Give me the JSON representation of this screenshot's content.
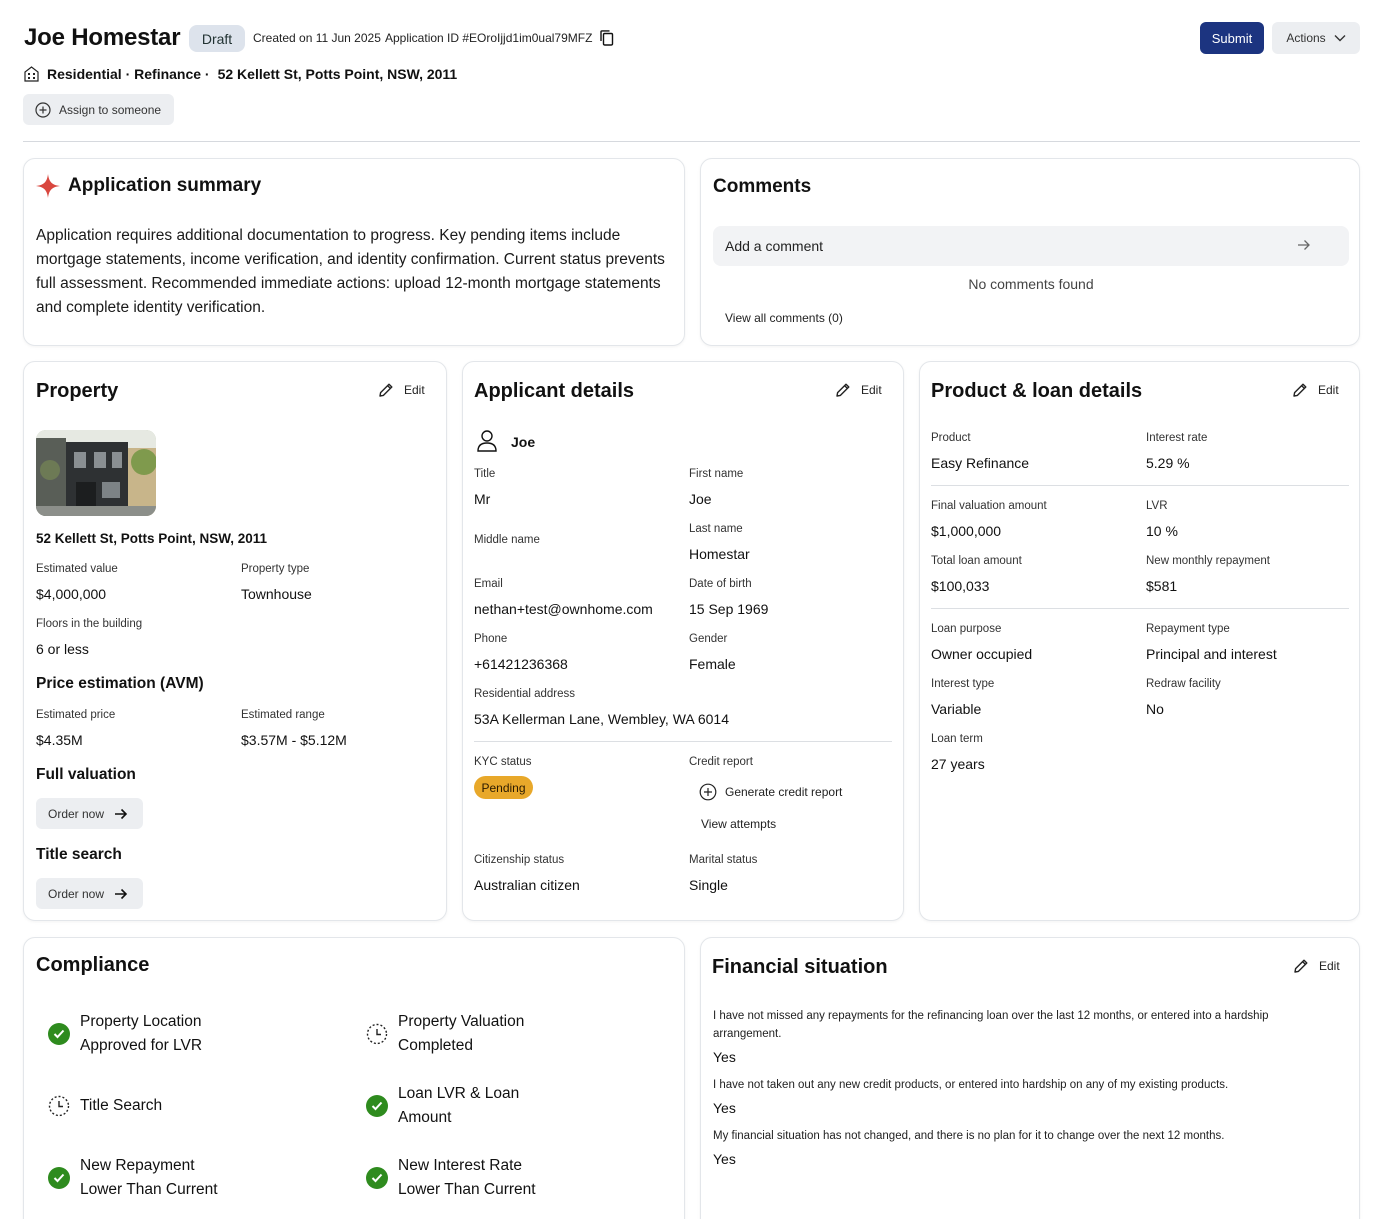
{
  "header": {
    "name": "Joe Homestar",
    "status": "Draft",
    "created": "Created on 11 Jun 2025",
    "app_id": "Application ID #EOroIjjd1im0ual79MFZ",
    "submit": "Submit",
    "actions": "Actions",
    "subline_type": "Residential · Refinance ·",
    "subline_address": "52 Kellett St, Potts Point, NSW, 2011",
    "assign": "Assign to someone"
  },
  "summary": {
    "title": "Application summary",
    "text": "Application requires additional documentation to progress. Key pending items include mortgage statements, income verification, and identity confirmation. Current status prevents full assessment. Recommended immediate actions: upload 12-month mortgage statements and complete identity verification."
  },
  "comments": {
    "title": "Comments",
    "placeholder": "Add a comment",
    "empty": "No comments found",
    "view_all": "View all comments (0)"
  },
  "property": {
    "title": "Property",
    "edit": "Edit",
    "address": "52 Kellett St, Potts Point, NSW, 2011",
    "est_value_label": "Estimated value",
    "est_value": "$4,000,000",
    "type_label": "Property type",
    "type": "Townhouse",
    "floors_label": "Floors in the building",
    "floors": "6 or less",
    "avm_title": "Price estimation (AVM)",
    "est_price_label": "Estimated price",
    "est_price": "$4.35M",
    "est_range_label": "Estimated range",
    "est_range": "$3.57M - $5.12M",
    "full_valuation": "Full valuation",
    "title_search": "Title search",
    "order_now": "Order now"
  },
  "applicant": {
    "title": "Applicant details",
    "edit": "Edit",
    "name": "Joe",
    "title_label": "Title",
    "title_value": "Mr",
    "first_label": "First name",
    "first_value": "Joe",
    "middle_label": "Middle name",
    "last_label": "Last name",
    "last_value": "Homestar",
    "email_label": "Email",
    "email_value": "nethan+test@ownhome.com",
    "dob_label": "Date of birth",
    "dob_value": "15 Sep 1969",
    "phone_label": "Phone",
    "phone_value": "+61421236368",
    "gender_label": "Gender",
    "gender_value": "Female",
    "addr_label": "Residential address",
    "addr_value": "53A Kellerman Lane, Wembley, WA 6014",
    "kyc_label": "KYC status",
    "kyc_value": "Pending",
    "credit_label": "Credit report",
    "credit_generate": "Generate credit report",
    "credit_attempts": "View attempts",
    "citizen_label": "Citizenship status",
    "citizen_value": "Australian citizen",
    "marital_label": "Marital status",
    "marital_value": "Single"
  },
  "loan": {
    "title": "Product & loan details",
    "edit": "Edit",
    "product_label": "Product",
    "product_value": "Easy Refinance",
    "rate_label": "Interest rate",
    "rate_value": "5.29 %",
    "valuation_label": "Final valuation amount",
    "valuation_value": "$1,000,000",
    "lvr_label": "LVR",
    "lvr_value": "10 %",
    "total_label": "Total loan amount",
    "total_value": "$100,033",
    "monthly_label": "New monthly repayment",
    "monthly_value": "$581",
    "purpose_label": "Loan purpose",
    "purpose_value": "Owner occupied",
    "repay_label": "Repayment type",
    "repay_value": "Principal and interest",
    "itype_label": "Interest type",
    "itype_value": "Variable",
    "redraw_label": "Redraw facility",
    "redraw_value": "No",
    "term_label": "Loan term",
    "term_value": "27 years"
  },
  "compliance": {
    "title": "Compliance",
    "items": [
      {
        "line1": "Property Location",
        "line2": "Approved for LVR",
        "state": "done"
      },
      {
        "line1": "Property Valuation",
        "line2": "Completed",
        "state": "pending"
      },
      {
        "line1": "Title Search",
        "line2": "",
        "state": "pending"
      },
      {
        "line1": "Loan LVR & Loan",
        "line2": "Amount",
        "state": "done"
      },
      {
        "line1": "New Repayment",
        "line2": "Lower Than Current",
        "state": "done"
      },
      {
        "line1": "New Interest Rate",
        "line2": "Lower Than Current",
        "state": "done"
      }
    ]
  },
  "financial": {
    "title": "Financial situation",
    "edit": "Edit",
    "q1": "I have not missed any repayments for the refinancing loan over the last 12 months, or entered into a hardship arrangement.",
    "a1": "Yes",
    "q2": "I have not taken out any new credit products, or entered into hardship on any of my existing products.",
    "a2": "Yes",
    "q3": "My financial situation has not changed, and there is no plan for it to change over the next 12 months.",
    "a3": "Yes"
  },
  "colors": {
    "primary": "#1c3480",
    "pending": "#e8a82a",
    "success": "#2e8b1e",
    "sparkle": "#d9473f"
  }
}
